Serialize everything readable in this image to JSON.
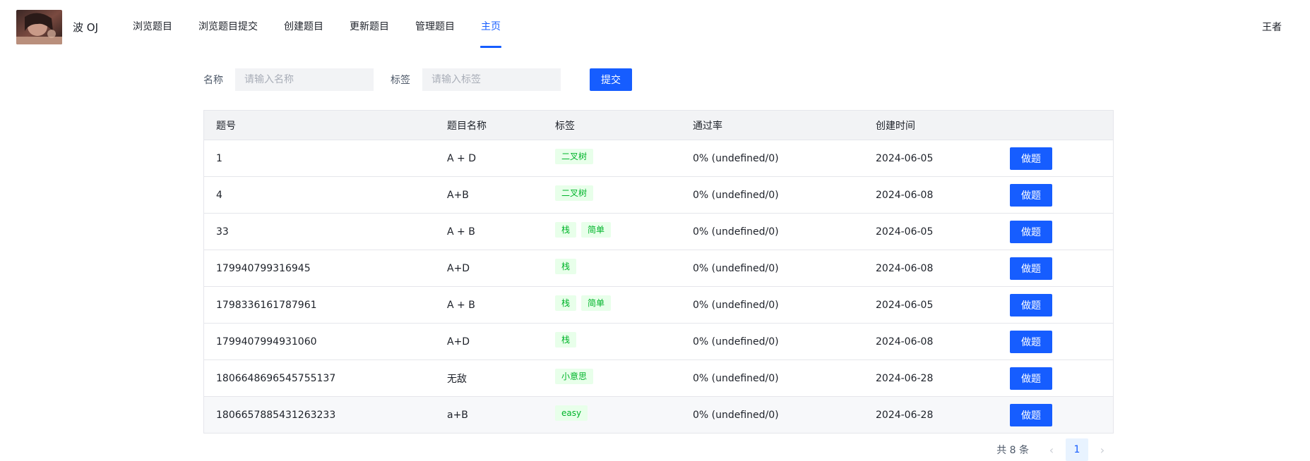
{
  "header": {
    "brand": "波 OJ",
    "nav": [
      {
        "label": "浏览题目",
        "active": false
      },
      {
        "label": "浏览题目提交",
        "active": false
      },
      {
        "label": "创建题目",
        "active": false
      },
      {
        "label": "更新题目",
        "active": false
      },
      {
        "label": "管理题目",
        "active": false
      },
      {
        "label": "主页",
        "active": true
      }
    ],
    "username": "王者"
  },
  "search": {
    "name_label": "名称",
    "name_placeholder": "请输入名称",
    "tag_label": "标签",
    "tag_placeholder": "请输入标签",
    "submit_label": "提交"
  },
  "table": {
    "columns": [
      "题号",
      "题目名称",
      "标签",
      "通过率",
      "创建时间",
      ""
    ],
    "rows": [
      {
        "id": "1",
        "title": "A + D",
        "tags": [
          "二叉树"
        ],
        "pass_rate": "0% (undefined/0)",
        "created": "2024-06-05",
        "action": "做题"
      },
      {
        "id": "4",
        "title": "A+B",
        "tags": [
          "二叉树"
        ],
        "pass_rate": "0% (undefined/0)",
        "created": "2024-06-08",
        "action": "做题"
      },
      {
        "id": "33",
        "title": "A + B",
        "tags": [
          "栈",
          "简单"
        ],
        "pass_rate": "0% (undefined/0)",
        "created": "2024-06-05",
        "action": "做题"
      },
      {
        "id": "179940799316945",
        "title": "A+D",
        "tags": [
          "栈"
        ],
        "pass_rate": "0% (undefined/0)",
        "created": "2024-06-08",
        "action": "做题"
      },
      {
        "id": "1798336161787961",
        "title": "A + B",
        "tags": [
          "栈",
          "简单"
        ],
        "pass_rate": "0% (undefined/0)",
        "created": "2024-06-05",
        "action": "做题"
      },
      {
        "id": "1799407994931060",
        "title": "A+D",
        "tags": [
          "栈"
        ],
        "pass_rate": "0% (undefined/0)",
        "created": "2024-06-08",
        "action": "做题"
      },
      {
        "id": "1806648696545755137",
        "title": "无敌",
        "tags": [
          "小意思"
        ],
        "pass_rate": "0% (undefined/0)",
        "created": "2024-06-28",
        "action": "做题"
      },
      {
        "id": "1806657885431263233",
        "title": "a+B",
        "tags": [
          "easy"
        ],
        "pass_rate": "0% (undefined/0)",
        "created": "2024-06-28",
        "action": "做题"
      }
    ]
  },
  "pagination": {
    "total": "共 8 条",
    "current": "1",
    "prev_icon": "chevron-left-icon",
    "next_icon": "chevron-right-icon"
  },
  "colors": {
    "accent": "#165dff",
    "tag_text": "#00b42a",
    "tag_bg": "#e8ffea"
  }
}
